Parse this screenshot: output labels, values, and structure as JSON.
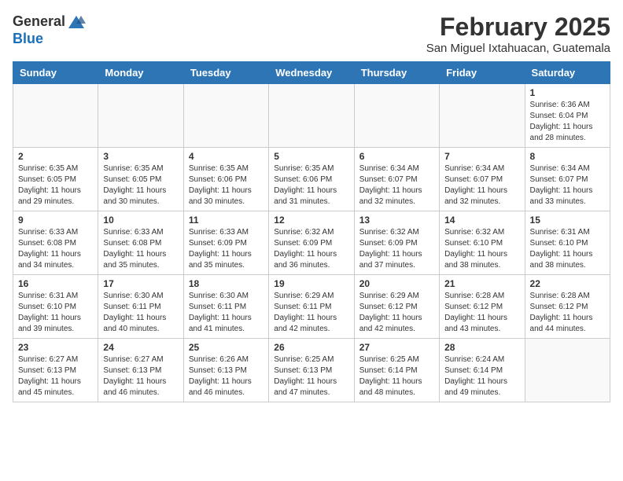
{
  "logo": {
    "general": "General",
    "blue": "Blue"
  },
  "title": "February 2025",
  "subtitle": "San Miguel Ixtahuacan, Guatemala",
  "days_of_week": [
    "Sunday",
    "Monday",
    "Tuesday",
    "Wednesday",
    "Thursday",
    "Friday",
    "Saturday"
  ],
  "weeks": [
    [
      {
        "day": "",
        "info": ""
      },
      {
        "day": "",
        "info": ""
      },
      {
        "day": "",
        "info": ""
      },
      {
        "day": "",
        "info": ""
      },
      {
        "day": "",
        "info": ""
      },
      {
        "day": "",
        "info": ""
      },
      {
        "day": "1",
        "info": "Sunrise: 6:36 AM\nSunset: 6:04 PM\nDaylight: 11 hours\nand 28 minutes."
      }
    ],
    [
      {
        "day": "2",
        "info": "Sunrise: 6:35 AM\nSunset: 6:05 PM\nDaylight: 11 hours\nand 29 minutes."
      },
      {
        "day": "3",
        "info": "Sunrise: 6:35 AM\nSunset: 6:05 PM\nDaylight: 11 hours\nand 30 minutes."
      },
      {
        "day": "4",
        "info": "Sunrise: 6:35 AM\nSunset: 6:06 PM\nDaylight: 11 hours\nand 30 minutes."
      },
      {
        "day": "5",
        "info": "Sunrise: 6:35 AM\nSunset: 6:06 PM\nDaylight: 11 hours\nand 31 minutes."
      },
      {
        "day": "6",
        "info": "Sunrise: 6:34 AM\nSunset: 6:07 PM\nDaylight: 11 hours\nand 32 minutes."
      },
      {
        "day": "7",
        "info": "Sunrise: 6:34 AM\nSunset: 6:07 PM\nDaylight: 11 hours\nand 32 minutes."
      },
      {
        "day": "8",
        "info": "Sunrise: 6:34 AM\nSunset: 6:07 PM\nDaylight: 11 hours\nand 33 minutes."
      }
    ],
    [
      {
        "day": "9",
        "info": "Sunrise: 6:33 AM\nSunset: 6:08 PM\nDaylight: 11 hours\nand 34 minutes."
      },
      {
        "day": "10",
        "info": "Sunrise: 6:33 AM\nSunset: 6:08 PM\nDaylight: 11 hours\nand 35 minutes."
      },
      {
        "day": "11",
        "info": "Sunrise: 6:33 AM\nSunset: 6:09 PM\nDaylight: 11 hours\nand 35 minutes."
      },
      {
        "day": "12",
        "info": "Sunrise: 6:32 AM\nSunset: 6:09 PM\nDaylight: 11 hours\nand 36 minutes."
      },
      {
        "day": "13",
        "info": "Sunrise: 6:32 AM\nSunset: 6:09 PM\nDaylight: 11 hours\nand 37 minutes."
      },
      {
        "day": "14",
        "info": "Sunrise: 6:32 AM\nSunset: 6:10 PM\nDaylight: 11 hours\nand 38 minutes."
      },
      {
        "day": "15",
        "info": "Sunrise: 6:31 AM\nSunset: 6:10 PM\nDaylight: 11 hours\nand 38 minutes."
      }
    ],
    [
      {
        "day": "16",
        "info": "Sunrise: 6:31 AM\nSunset: 6:10 PM\nDaylight: 11 hours\nand 39 minutes."
      },
      {
        "day": "17",
        "info": "Sunrise: 6:30 AM\nSunset: 6:11 PM\nDaylight: 11 hours\nand 40 minutes."
      },
      {
        "day": "18",
        "info": "Sunrise: 6:30 AM\nSunset: 6:11 PM\nDaylight: 11 hours\nand 41 minutes."
      },
      {
        "day": "19",
        "info": "Sunrise: 6:29 AM\nSunset: 6:11 PM\nDaylight: 11 hours\nand 42 minutes."
      },
      {
        "day": "20",
        "info": "Sunrise: 6:29 AM\nSunset: 6:12 PM\nDaylight: 11 hours\nand 42 minutes."
      },
      {
        "day": "21",
        "info": "Sunrise: 6:28 AM\nSunset: 6:12 PM\nDaylight: 11 hours\nand 43 minutes."
      },
      {
        "day": "22",
        "info": "Sunrise: 6:28 AM\nSunset: 6:12 PM\nDaylight: 11 hours\nand 44 minutes."
      }
    ],
    [
      {
        "day": "23",
        "info": "Sunrise: 6:27 AM\nSunset: 6:13 PM\nDaylight: 11 hours\nand 45 minutes."
      },
      {
        "day": "24",
        "info": "Sunrise: 6:27 AM\nSunset: 6:13 PM\nDaylight: 11 hours\nand 46 minutes."
      },
      {
        "day": "25",
        "info": "Sunrise: 6:26 AM\nSunset: 6:13 PM\nDaylight: 11 hours\nand 46 minutes."
      },
      {
        "day": "26",
        "info": "Sunrise: 6:25 AM\nSunset: 6:13 PM\nDaylight: 11 hours\nand 47 minutes."
      },
      {
        "day": "27",
        "info": "Sunrise: 6:25 AM\nSunset: 6:14 PM\nDaylight: 11 hours\nand 48 minutes."
      },
      {
        "day": "28",
        "info": "Sunrise: 6:24 AM\nSunset: 6:14 PM\nDaylight: 11 hours\nand 49 minutes."
      },
      {
        "day": "",
        "info": ""
      }
    ]
  ]
}
